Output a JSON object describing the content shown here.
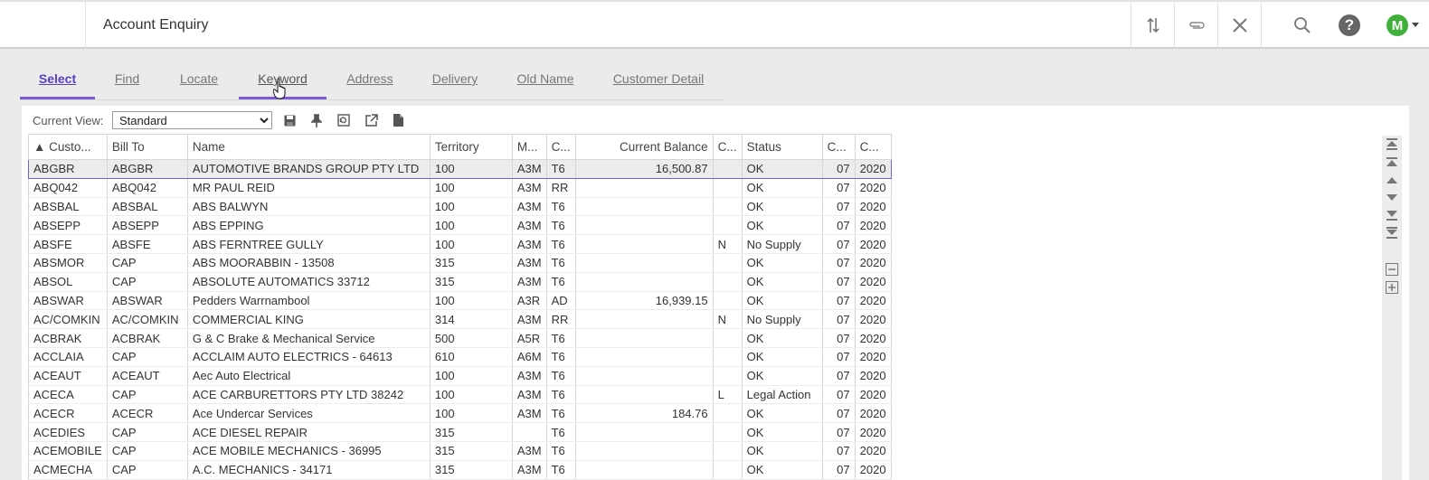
{
  "header": {
    "title": "Account Enquiry",
    "avatar_initial": "M",
    "icons": [
      "sort-arrows-icon",
      "paperclip-icon",
      "close-icon",
      "search-icon",
      "help-icon"
    ]
  },
  "tabs": [
    {
      "label": "Select"
    },
    {
      "label": "Find"
    },
    {
      "label": "Locate"
    },
    {
      "label": "Keyword"
    },
    {
      "label": "Address"
    },
    {
      "label": "Delivery"
    },
    {
      "label": "Old Name"
    },
    {
      "label": "Customer Detail"
    }
  ],
  "active_tab": "Select",
  "toolbar": {
    "current_view_label": "Current View:",
    "current_view_value": "Standard",
    "icons": [
      "save-icon",
      "pin-icon",
      "restore-icon",
      "export-icon",
      "document-icon"
    ]
  },
  "grid": {
    "columns": [
      "▲ Custo...",
      "Bill To",
      "Name",
      "Territory",
      "M...",
      "C...",
      "Current Balance",
      "C...",
      "Status",
      "C...",
      "C..."
    ],
    "rows": [
      [
        "ABGBR",
        "ABGBR",
        "AUTOMOTIVE BRANDS GROUP PTY LTD",
        "100",
        "A3M",
        "T6",
        "16,500.87",
        "",
        "OK",
        "07",
        "2020"
      ],
      [
        "ABQ042",
        "ABQ042",
        "MR PAUL REID",
        "100",
        "A3M",
        "RR",
        "",
        "",
        "OK",
        "07",
        "2020"
      ],
      [
        "ABSBAL",
        "ABSBAL",
        "ABS BALWYN",
        "100",
        "A3M",
        "T6",
        "",
        "",
        "OK",
        "07",
        "2020"
      ],
      [
        "ABSEPP",
        "ABSEPP",
        "ABS EPPING",
        "100",
        "A3M",
        "T6",
        "",
        "",
        "OK",
        "07",
        "2020"
      ],
      [
        "ABSFE",
        "ABSFE",
        "ABS FERNTREE GULLY",
        "100",
        "A3M",
        "T6",
        "",
        "N",
        "No Supply",
        "07",
        "2020"
      ],
      [
        "ABSMOR",
        "CAP",
        "ABS MOORABBIN - 13508",
        "315",
        "A3M",
        "T6",
        "",
        "",
        "OK",
        "07",
        "2020"
      ],
      [
        "ABSOL",
        "CAP",
        "ABSOLUTE AUTOMATICS  33712",
        "315",
        "A3M",
        "T6",
        "",
        "",
        "OK",
        "07",
        "2020"
      ],
      [
        "ABSWAR",
        "ABSWAR",
        "Pedders Warrnambool",
        "100",
        "A3R",
        "AD",
        "16,939.15",
        "",
        "OK",
        "07",
        "2020"
      ],
      [
        "AC/COMKIN",
        "AC/COMKIN",
        "COMMERCIAL KING",
        "314",
        "A3M",
        "RR",
        "",
        "N",
        "No Supply",
        "07",
        "2020"
      ],
      [
        "ACBRAK",
        "ACBRAK",
        "G & C Brake & Mechanical Service",
        "500",
        "A5R",
        "T6",
        "",
        "",
        "OK",
        "07",
        "2020"
      ],
      [
        "ACCLAIA",
        "CAP",
        "ACCLAIM AUTO ELECTRICS -  64613",
        "610",
        "A6M",
        "T6",
        "",
        "",
        "OK",
        "07",
        "2020"
      ],
      [
        "ACEAUT",
        "ACEAUT",
        "Aec Auto Electrical",
        "100",
        "A3M",
        "T6",
        "",
        "",
        "OK",
        "07",
        "2020"
      ],
      [
        "ACECA",
        "CAP",
        "ACE CARBURETTORS PTY LTD 38242",
        "100",
        "A3M",
        "T6",
        "",
        "L",
        "Legal Action",
        "07",
        "2020"
      ],
      [
        "ACECR",
        "ACECR",
        "Ace Undercar Services",
        "100",
        "A3M",
        "T6",
        "184.76",
        "",
        "OK",
        "07",
        "2020"
      ],
      [
        "ACEDIES",
        "CAP",
        "ACE DIESEL REPAIR",
        "315",
        "",
        "T6",
        "",
        "",
        "OK",
        "07",
        "2020"
      ],
      [
        "ACEMOBILE",
        "CAP",
        "ACE MOBILE MECHANICS - 36995",
        "315",
        "A3M",
        "T6",
        "",
        "",
        "OK",
        "07",
        "2020"
      ],
      [
        "ACMECHA",
        "CAP",
        "A.C. MECHANICS - 34171",
        "315",
        "A3M",
        "T6",
        "",
        "",
        "OK",
        "07",
        "2020"
      ]
    ]
  },
  "nav_icons": [
    "first-page-icon",
    "page-up-icon",
    "row-up-icon",
    "row-down-icon",
    "page-down-icon",
    "last-page-icon",
    "collapse-icon",
    "expand-icon"
  ]
}
